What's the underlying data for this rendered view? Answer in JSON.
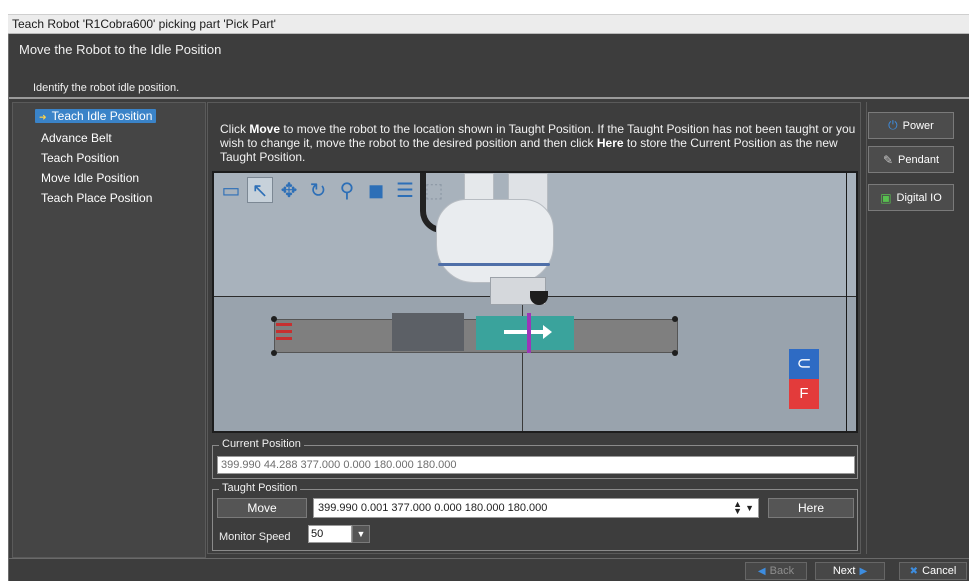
{
  "window": {
    "title": "Teach Robot 'R1Cobra600' picking part 'Pick Part'"
  },
  "header": {
    "title": "Move the Robot to the Idle Position",
    "subtitle": "Identify the robot idle position."
  },
  "steps": [
    {
      "label": "Teach Idle Position",
      "active": true
    },
    {
      "label": "Advance Belt"
    },
    {
      "label": "Teach Position"
    },
    {
      "label": "Move Idle Position"
    },
    {
      "label": "Teach Place Position"
    }
  ],
  "instructions": {
    "part1": "Click ",
    "bold1": "Move",
    "part2": " to move the robot to the location shown in Taught Position. If the Taught Position has not been taught or you wish to change it, move the robot to the desired position and then click ",
    "bold2": "Here",
    "part3": " to store the Current Position as the new Taught Position."
  },
  "viewport": {
    "tools": [
      "window-icon",
      "select-arrow-icon",
      "pan-icon",
      "rotate-icon",
      "zoom-icon",
      "cube-icon",
      "properties-icon",
      "box-outline-icon"
    ],
    "nav_cube_top": "⊂",
    "nav_cube_bottom": "F"
  },
  "current_position": {
    "legend": "Current Position",
    "value": "399.990 44.288 377.000 0.000 180.000 180.000"
  },
  "taught_position": {
    "legend": "Taught Position",
    "move_label": "Move",
    "value": "399.990 0.001 377.000 0.000 180.000 180.000",
    "here_label": "Here",
    "monitor_speed_label": "Monitor Speed",
    "monitor_speed_value": "50"
  },
  "side_buttons": {
    "power": "Power",
    "pendant": "Pendant",
    "digital_io": "Digital IO"
  },
  "footer": {
    "back": "Back",
    "next": "Next",
    "cancel": "Cancel"
  },
  "colors": {
    "accent": "#3a83c8",
    "background": "#3d3d3d",
    "nav_cube_blue": "#2e6bc4",
    "nav_cube_red": "#e33b3b"
  }
}
